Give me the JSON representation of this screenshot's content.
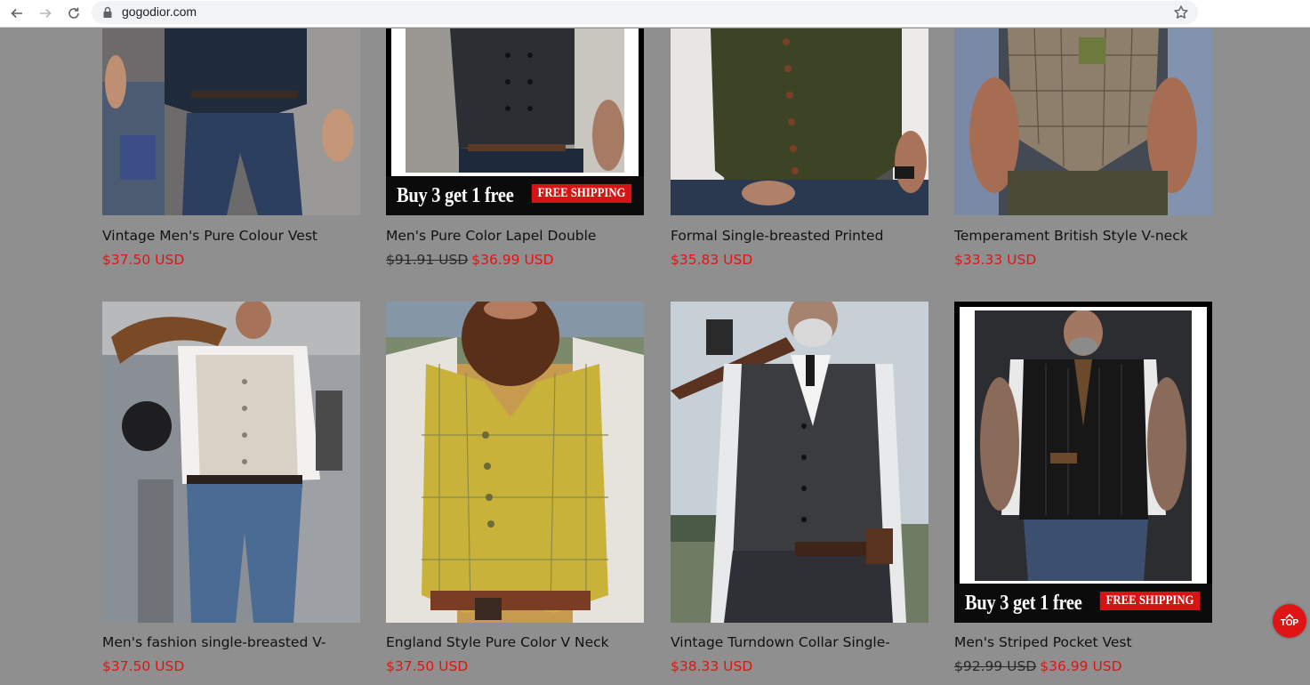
{
  "browser": {
    "url": "gogodior.com",
    "icons": [
      "back-arrow-icon",
      "forward-arrow-icon",
      "reload-icon",
      "lock-icon",
      "star-icon"
    ]
  },
  "promo": {
    "text": "Buy 3 get 1 free",
    "badge": "FREE SHIPPING"
  },
  "products": [
    {
      "title": "Vintage Men's Pure Colour Vest",
      "old_price": "",
      "price": "$37.50 USD"
    },
    {
      "title": "Men's Pure Color Lapel Double",
      "old_price": "$91.91 USD",
      "price": "$36.99 USD"
    },
    {
      "title": "Formal Single-breasted Printed",
      "old_price": "",
      "price": "$35.83 USD"
    },
    {
      "title": "Temperament British Style V-neck",
      "old_price": "",
      "price": "$33.33 USD"
    },
    {
      "title": "Men's fashion single-breasted V-",
      "old_price": "",
      "price": "$37.50 USD"
    },
    {
      "title": "England Style Pure Color V Neck",
      "old_price": "",
      "price": "$37.50 USD"
    },
    {
      "title": "Vintage Turndown Collar Single-",
      "old_price": "",
      "price": "$38.33 USD"
    },
    {
      "title": "Men's Striped Pocket Vest",
      "old_price": "$92.99 USD",
      "price": "$36.99 USD"
    }
  ],
  "top_button": {
    "label": "TOP"
  },
  "colors": {
    "price_red": "#e31313",
    "background": "#8f8f8f",
    "promo_red": "#d71414"
  }
}
